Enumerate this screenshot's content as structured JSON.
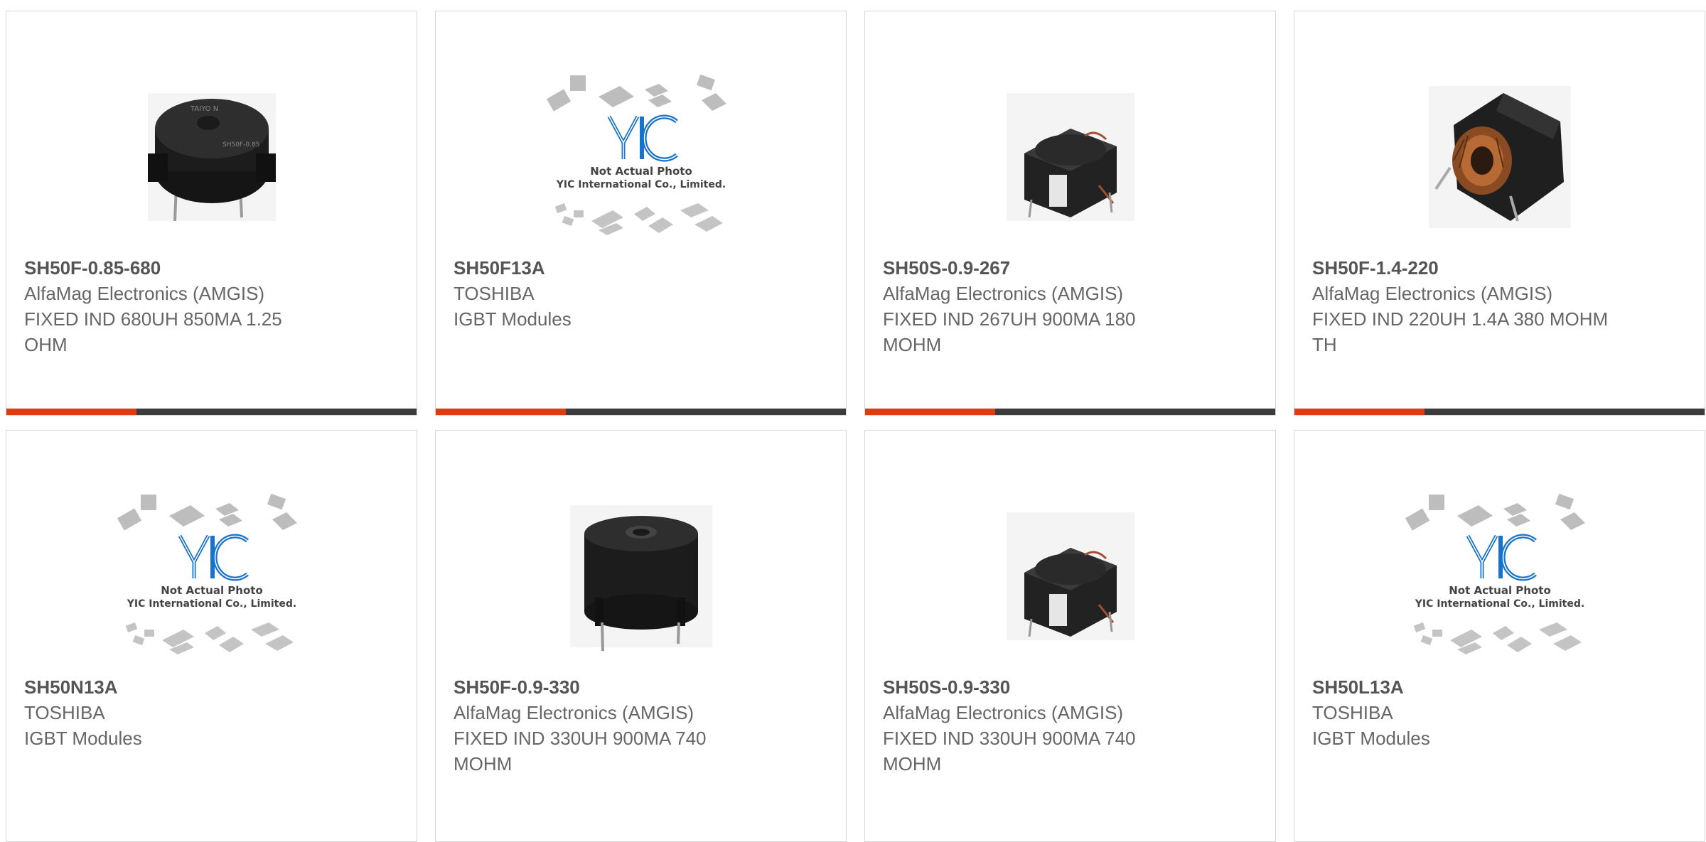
{
  "products": [
    {
      "part": "SH50F-0.85-680",
      "maker": "AlfaMag Electronics (AMGIS)",
      "desc": "FIXED IND 680UH 850MA 1.25 OHM",
      "image": "drum-inductor-top-icon"
    },
    {
      "part": "SH50F13A",
      "maker": "TOSHIBA",
      "desc": "IGBT Modules",
      "image": "not-actual-photo-placeholder"
    },
    {
      "part": "SH50S-0.9-267",
      "maker": "AlfaMag Electronics (AMGIS)",
      "desc": "FIXED IND 267UH 900MA 180 MOHM",
      "image": "square-inductor-icon"
    },
    {
      "part": "SH50F-1.4-220",
      "maker": "AlfaMag Electronics (AMGIS)",
      "desc": "FIXED IND 220UH 1.4A 380 MOHM TH",
      "image": "toroid-inductor-icon"
    },
    {
      "part": "SH50N13A",
      "maker": "TOSHIBA",
      "desc": "IGBT Modules",
      "image": "not-actual-photo-placeholder"
    },
    {
      "part": "SH50F-0.9-330",
      "maker": "AlfaMag Electronics (AMGIS)",
      "desc": "FIXED IND 330UH 900MA 740 MOHM",
      "image": "drum-inductor-side-icon"
    },
    {
      "part": "SH50S-0.9-330",
      "maker": "AlfaMag Electronics (AMGIS)",
      "desc": "FIXED IND 330UH 900MA 740 MOHM",
      "image": "square-inductor-icon"
    },
    {
      "part": "SH50L13A",
      "maker": "TOSHIBA",
      "desc": "IGBT Modules",
      "image": "not-actual-photo-placeholder"
    }
  ],
  "placeholder": {
    "logo": "YIC",
    "line1": "Not Actual Photo",
    "line2": "YIC International Co., Limited."
  },
  "colors": {
    "accent": "#e03a11",
    "bar": "#3b3b3b",
    "text": "#666666",
    "logo_blue": "#1a73c8"
  }
}
